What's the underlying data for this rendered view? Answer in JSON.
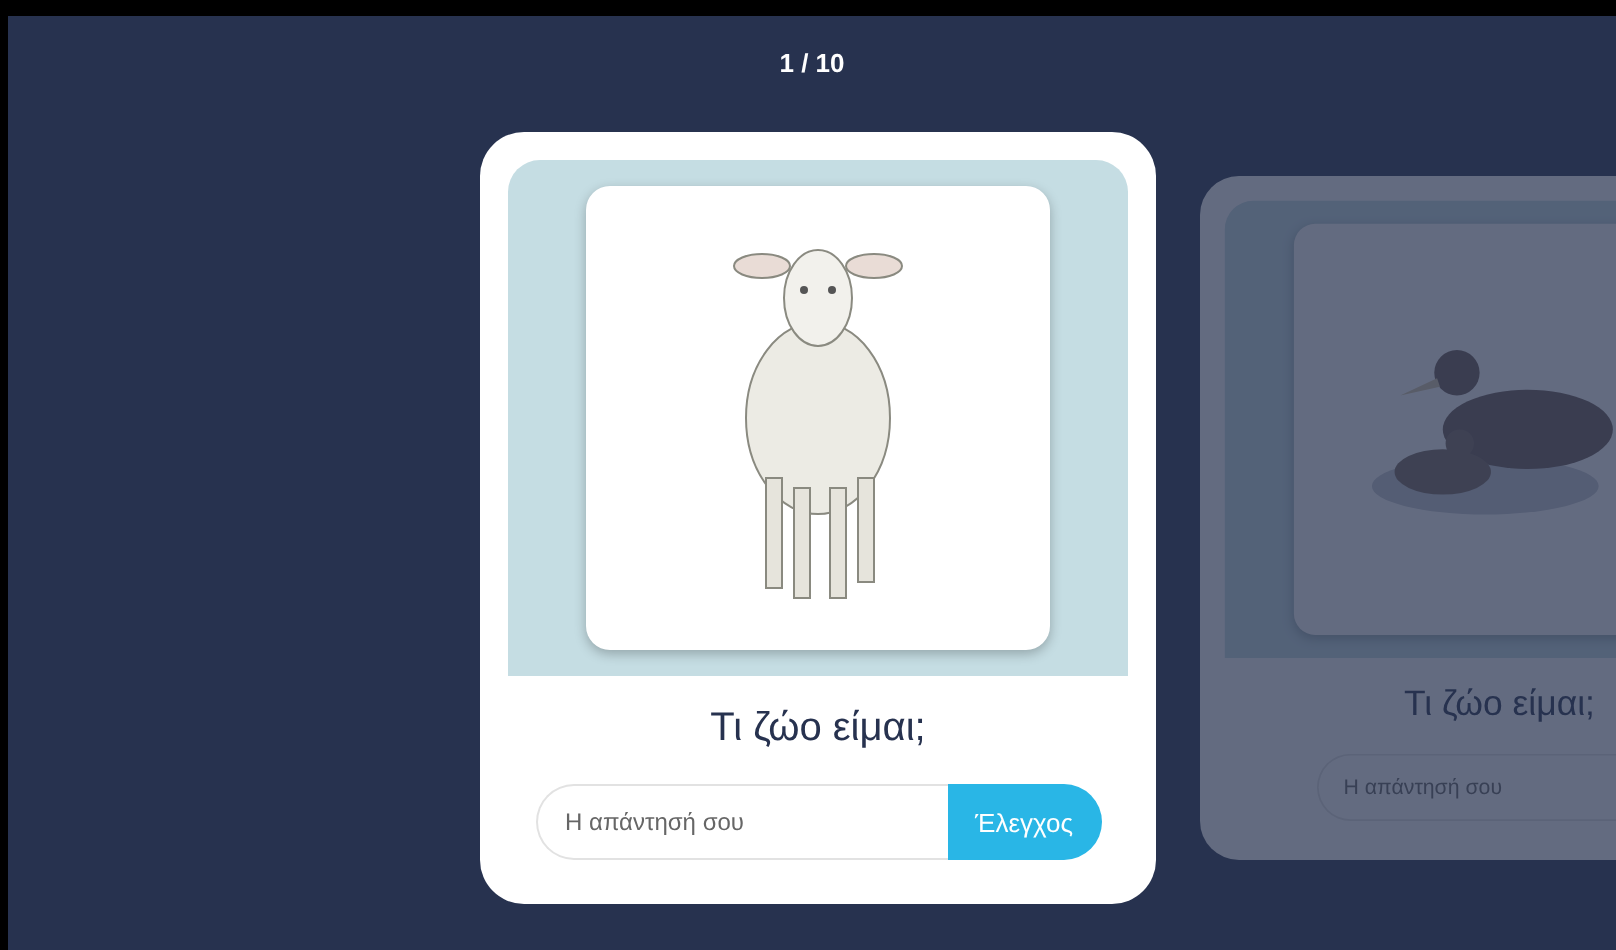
{
  "counter": "1 / 10",
  "cards": [
    {
      "active": true,
      "question": "Τι ζώο είμαι;",
      "answer": {
        "placeholder": "Η απάντησή σου"
      },
      "check_button": "Έλεγχος"
    },
    {
      "active": false,
      "question": "Τι ζώο είμαι;",
      "answer": {
        "placeholder": "Η απάντησή σου"
      }
    }
  ]
}
